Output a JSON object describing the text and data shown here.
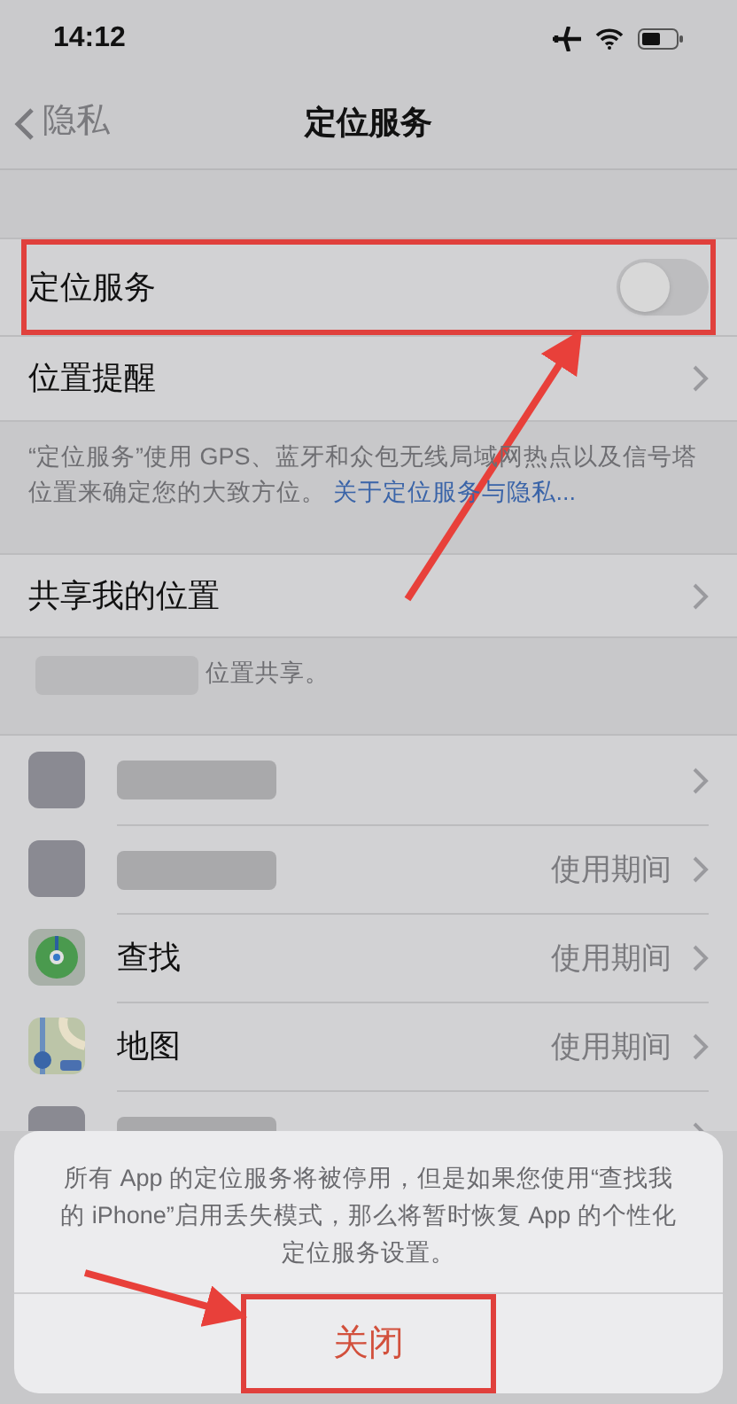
{
  "status_bar": {
    "time": "14:12"
  },
  "nav": {
    "back": "隐私",
    "title": "定位服务"
  },
  "settings": [
    {
      "kind": "toggle",
      "label": "定位服务",
      "on": false,
      "highlighted": true
    },
    {
      "kind": "link",
      "label": "位置提醒",
      "highlighted": false
    }
  ],
  "footer_1": {
    "text": "“定位服务”使用 GPS、蓝牙和众包无线局域网热点以及信号塔位置来确定您的大致方位。",
    "link": "关于定位服务与隐私..."
  },
  "share_row": {
    "label": "共享我的位置"
  },
  "footer_2": {
    "text": "位置共享。"
  },
  "apps": [
    {
      "kind": "blurred"
    },
    {
      "kind": "blurred",
      "access": "使用期间"
    },
    {
      "kind": "find",
      "name": "查找",
      "access": "使用期间"
    },
    {
      "kind": "maps",
      "name": "地图",
      "access": "使用期间"
    },
    {
      "kind": "blurred"
    }
  ],
  "alert": {
    "message": "所有 App 的定位服务将被停用，但是如果您使用“查找我的 iPhone”启用丢失模式，那么将暂时恢复 App 的个性化定位服务设置。",
    "button": "关闭",
    "highlighted": true
  }
}
